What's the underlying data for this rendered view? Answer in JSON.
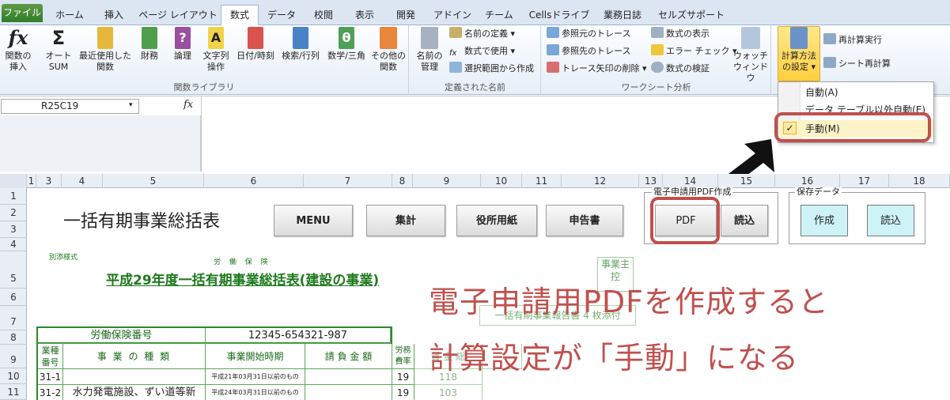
{
  "tabs": [
    "ファイル",
    "ホーム",
    "挿入",
    "ページ レイアウト",
    "数式",
    "データ",
    "校閲",
    "表示",
    "開発",
    "アドイン",
    "チーム",
    "Cellsドライブ",
    "業務日誌",
    "セルズサポート"
  ],
  "ribbon": {
    "function_library": {
      "label": "関数ライブラリ",
      "insert_function": "関数の挿入",
      "autosum": "オート SUM",
      "recent": "最近使用した 関数",
      "financial": "財務",
      "logical": "論理",
      "text": "文字列 操作",
      "datetime": "日付/時刻",
      "lookup": "検索/行列",
      "math": "数学/三角",
      "more": "その他の 関数"
    },
    "defined_names": {
      "label": "定義された名前",
      "name_manager": "名前の 管理",
      "define_name": "名前の定義",
      "use_in_formula": "数式で使用",
      "create_from_selection": "選択範囲から作成"
    },
    "formula_auditing": {
      "label": "ワークシート分析",
      "trace_precedents": "参照元のトレース",
      "trace_dependents": "参照先のトレース",
      "remove_arrows": "トレース矢印の削除",
      "show_formulas": "数式の表示",
      "error_checking": "エラー チェック",
      "evaluate_formula": "数式の検証",
      "watch_window": "ウォッチ ウィンドウ"
    },
    "calculation": {
      "calc_options": "計算方法 の設定",
      "calc_now": "再計算実行",
      "calc_sheet": "シート再計算"
    }
  },
  "calc_menu": {
    "auto": "自動(A)",
    "auto_except_tables": "データ テーブル以外自動(E)",
    "manual": "手動(M)",
    "check": "✓"
  },
  "formula_bar": {
    "name_box": "R25C19",
    "fx": "fx"
  },
  "columns": [
    "1",
    "3",
    "4",
    "5",
    "6",
    "7",
    "8",
    "9",
    "10",
    "11",
    "12",
    "13",
    "14",
    "15",
    "16",
    "17",
    "18"
  ],
  "rows": [
    "1",
    "2",
    "3",
    "4",
    "5",
    "6",
    "7",
    "8",
    "9",
    "10",
    "11"
  ],
  "sheet": {
    "title": "一括有期事業総括表",
    "buttons": {
      "menu": "MENU",
      "sum": "集計",
      "office": "役所用紙",
      "report": "申告書",
      "pdf": "PDF",
      "load": "読込"
    },
    "pdf_group_label": "電子申請用PDF作成",
    "save_group_label": "保存データ",
    "save_create": "作成",
    "save_load": "読込",
    "form_note": "別添様式",
    "header_small": "労 働 保 険",
    "form_title": "平成29年度一括有期事業総括表(建設の事業)",
    "side_box": "事業主控",
    "report_note": "一括有期事業報告書 4 枚添付",
    "insurance_no_label": "労働保険番号",
    "insurance_no": "12345-654321-987",
    "col_type_code": "業種番号",
    "col_business_type": "事 業 の 種 類",
    "col_start_period": "事業開始時期",
    "col_contract_amount": "請 負 金 額",
    "col_labor_rate": "労務費率",
    "col_wage_total": "賃 金 総",
    "rows": [
      {
        "code": "31-1",
        "period": "平成21年03月31日以前のもの",
        "rate": "19",
        "value": "118"
      },
      {
        "code": "31-2",
        "business": "水力発電施設、ずい道等新",
        "period": "平成24年03月31日以前のもの",
        "rate": "19",
        "value": "103"
      }
    ]
  },
  "annotation": {
    "line1": "電子申請用PDFを作成すると",
    "line2": "計算設定が「手動」になる"
  }
}
